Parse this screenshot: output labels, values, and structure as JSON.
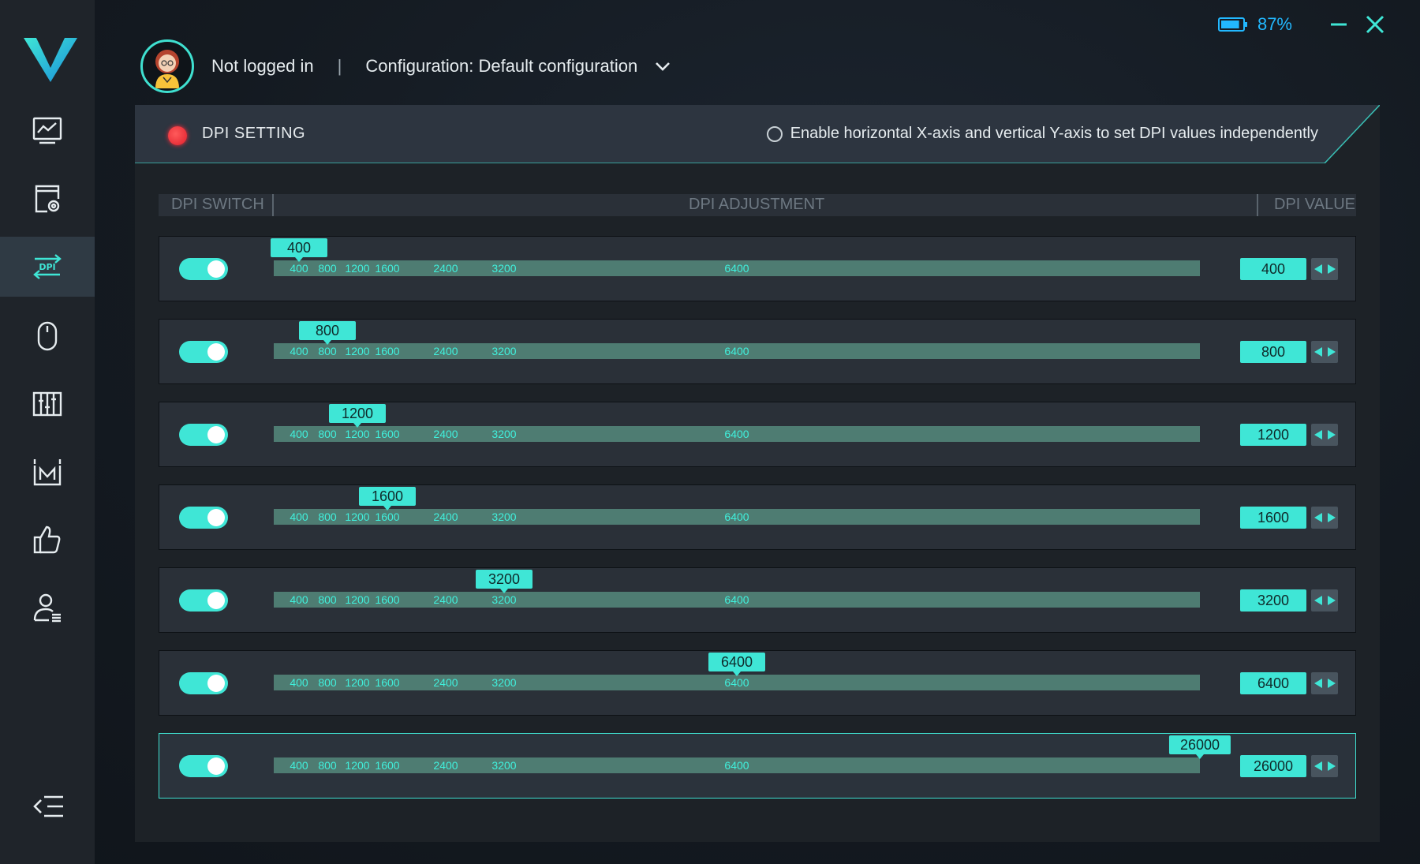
{
  "header": {
    "user_status": "Not logged in",
    "separator": "|",
    "configuration_label": "Configuration: Default configuration",
    "battery_percent": "87%",
    "battery_level": 0.87
  },
  "sidebar": {
    "items": [
      {
        "icon": "performance-monitor-icon",
        "active": false
      },
      {
        "icon": "screen-settings-icon",
        "active": false
      },
      {
        "icon": "dpi-icon",
        "label": "DPI",
        "active": true
      },
      {
        "icon": "mouse-icon",
        "active": false
      },
      {
        "icon": "equalizer-icon",
        "active": false
      },
      {
        "icon": "macro-icon",
        "label": "M",
        "active": false
      },
      {
        "icon": "thumbs-up-icon",
        "active": false
      },
      {
        "icon": "user-account-icon",
        "active": false
      }
    ]
  },
  "panel": {
    "title": "DPI SETTING",
    "independent_axes_label": "Enable horizontal X-axis and vertical Y-axis to set DPI values independently",
    "independent_axes_enabled": false,
    "columns": {
      "switch": "DPI SWITCH",
      "adjustment": "DPI ADJUSTMENT",
      "value": "DPI VALUE"
    },
    "scale_ticks": [
      "400",
      "800",
      "1200",
      "1600",
      "2400",
      "3200",
      "6400"
    ],
    "slider_min": 400,
    "slider_max": 26000,
    "rows": [
      {
        "enabled": true,
        "value": "400",
        "active": false
      },
      {
        "enabled": true,
        "value": "800",
        "active": false
      },
      {
        "enabled": true,
        "value": "1200",
        "active": false
      },
      {
        "enabled": true,
        "value": "1600",
        "active": false
      },
      {
        "enabled": true,
        "value": "3200",
        "active": false
      },
      {
        "enabled": true,
        "value": "6400",
        "active": false
      },
      {
        "enabled": true,
        "value": "26000",
        "active": true
      }
    ]
  },
  "colors": {
    "accent": "#3fe6d6",
    "track": "#4e7c72",
    "status_red": "#e01f2c",
    "battery_blue": "#22b8ff"
  }
}
